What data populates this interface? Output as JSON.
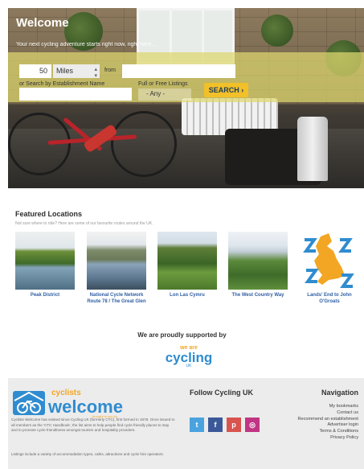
{
  "hero": {
    "title": "Welcome",
    "tagline": "Your next cycling adventure starts right now, right here..."
  },
  "search": {
    "distance_value": "50",
    "distance_unit": "Miles",
    "from_label": "from",
    "from_value": "",
    "establishment_label": "or Search by Establishment Name",
    "establishment_value": "",
    "listing_label": "Full or Free Listings",
    "listing_value": "- Any -",
    "search_button": "SEARCH"
  },
  "featured": {
    "title": "Featured Locations",
    "subtitle": "Not sure where to ride? Here are some of our favourite routes around the UK.",
    "items": [
      {
        "label": "Peak District"
      },
      {
        "label": "National Cycle Network Route 78 / The Great Glen"
      },
      {
        "label": "Lon Las Cymru"
      },
      {
        "label": "The West Country Way"
      },
      {
        "label": "Lands' End to John O'Groats"
      }
    ]
  },
  "support": {
    "text": "We are proudly supported by",
    "logo_small": "we are",
    "logo_big": "cycling",
    "logo_uk": "UK"
  },
  "footer": {
    "logo_small": "cyclists",
    "logo_big": "welcome",
    "logo_strap": "brought to you by",
    "about_1": "Cyclists Welcome has existed since Cycling UK (formerly CTC), first formed in 1878. Once issued to all members as the 'CTC Handbook', the list aims to help people find cycle friendly places to stay and to promote cycle friendliness amongst tourism and hospitality providers.",
    "about_2": "Listings include a variety of accommodation types, cafes, attractions and cycle hire operators.",
    "follow_title": "Follow Cycling UK",
    "social": [
      {
        "name": "twitter-icon",
        "glyph": "t",
        "color": "#4aa3df"
      },
      {
        "name": "facebook-icon",
        "glyph": "f",
        "color": "#3b5998"
      },
      {
        "name": "pinterest-icon",
        "glyph": "p",
        "color": "#d9534f"
      },
      {
        "name": "instagram-icon",
        "glyph": "◎",
        "color": "#c13584"
      }
    ],
    "nav_title": "Navigation",
    "nav_links": [
      "My bookmarks",
      "Contact us",
      "Recommend an establishment",
      "Advertiser login",
      "Terms & Conditions",
      "Privacy Policy"
    ]
  }
}
